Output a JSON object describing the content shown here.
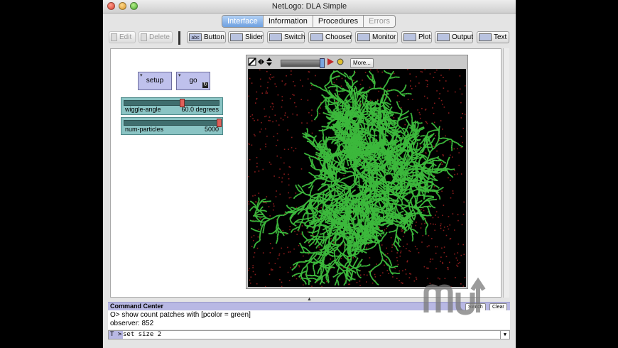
{
  "window": {
    "title": "NetLogo: DLA Simple"
  },
  "tabs": [
    {
      "label": "Interface"
    },
    {
      "label": "Information"
    },
    {
      "label": "Procedures"
    },
    {
      "label": "Errors"
    }
  ],
  "toolbar": {
    "edit_label": "Edit",
    "delete_label": "Delete",
    "items": [
      {
        "label": "Button",
        "icon": "abc"
      },
      {
        "label": "Slider",
        "icon": ""
      },
      {
        "label": "Switch",
        "icon": ""
      },
      {
        "label": "Chooser",
        "icon": ""
      },
      {
        "label": "Monitor",
        "icon": ""
      },
      {
        "label": "Plot",
        "icon": ""
      },
      {
        "label": "Output",
        "icon": ""
      },
      {
        "label": "Text",
        "icon": ""
      }
    ]
  },
  "interface": {
    "buttons": {
      "setup": "setup",
      "go": "go"
    },
    "sliders": [
      {
        "name": "wiggle-angle",
        "value": "60.0 degrees",
        "fraction": 0.6
      },
      {
        "name": "num-particles",
        "value": "5000",
        "fraction": 1.0
      }
    ],
    "view": {
      "more_label": "More...",
      "speed_fraction": 0.95
    }
  },
  "command_center": {
    "title": "Command Center",
    "switch_label": "Switch",
    "clear_label": "Clear",
    "output": [
      "O> show count patches with [pcolor = green]",
      "observer: 852"
    ],
    "agent_prompt": "T >",
    "input": "set size 2"
  },
  "colors": {
    "aggregate": "#3cb83c",
    "particle": "#8a1c1c",
    "slider": "#8ac4c4",
    "button": "#bfc1ec"
  }
}
